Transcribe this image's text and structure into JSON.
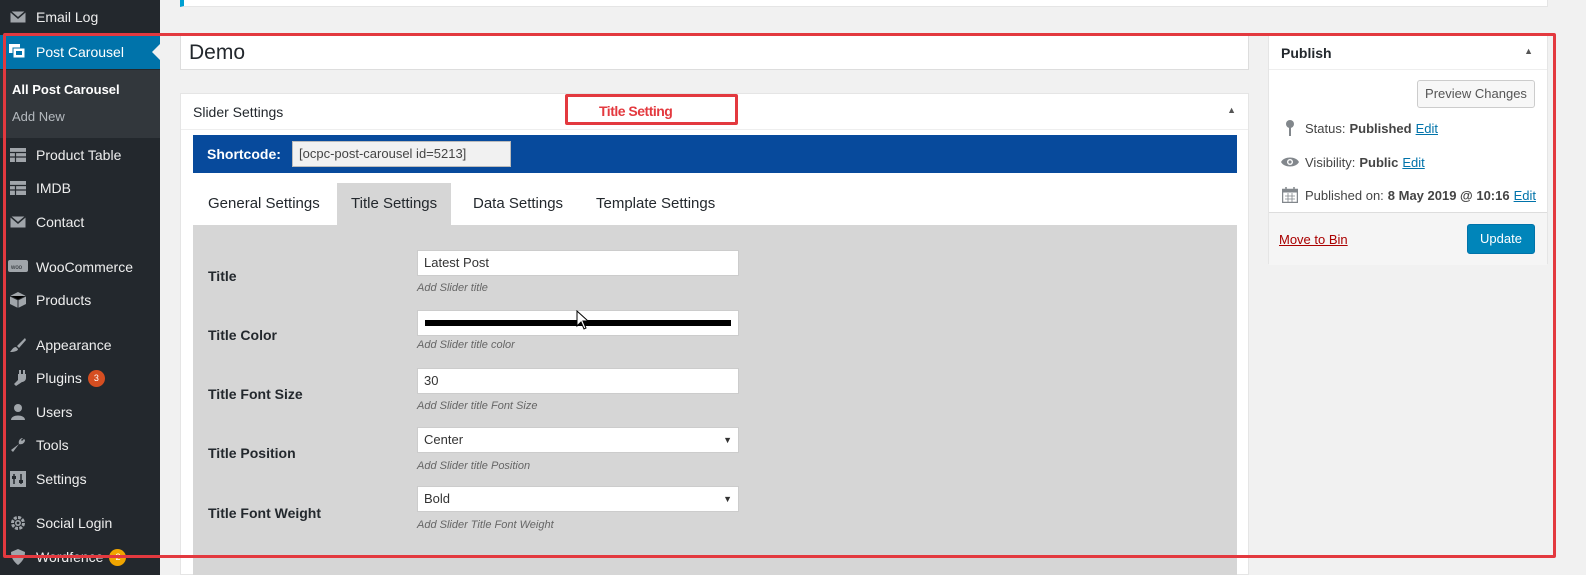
{
  "sidebar": {
    "items": [
      {
        "label": "Email Log",
        "icon": "mail-icon"
      },
      {
        "label": "Post Carousel",
        "icon": "carousel-icon",
        "active": true
      },
      {
        "label": "Product Table",
        "icon": "table-icon"
      },
      {
        "label": "IMDB",
        "icon": "table-icon"
      },
      {
        "label": "Contact",
        "icon": "mail-icon"
      },
      {
        "label": "WooCommerce",
        "icon": "woo-icon"
      },
      {
        "label": "Products",
        "icon": "box-icon"
      },
      {
        "label": "Appearance",
        "icon": "brush-icon"
      },
      {
        "label": "Plugins",
        "icon": "plug-icon",
        "badge": "3"
      },
      {
        "label": "Users",
        "icon": "user-icon"
      },
      {
        "label": "Tools",
        "icon": "wrench-icon"
      },
      {
        "label": "Settings",
        "icon": "settings-icon"
      },
      {
        "label": "Social Login",
        "icon": "gear-icon"
      },
      {
        "label": "Wordfence",
        "icon": "shield-icon",
        "badge": "2"
      }
    ],
    "submenu": {
      "all": "All Post Carousel",
      "add_new": "Add New"
    }
  },
  "post": {
    "title": "Demo"
  },
  "slider": {
    "box_title": "Slider Settings",
    "shortcode_label": "Shortcode:",
    "shortcode_value": "[ocpc-post-carousel id=5213]",
    "tabs": [
      {
        "label": "General Settings"
      },
      {
        "label": "Title Settings",
        "active": true
      },
      {
        "label": "Data Settings"
      },
      {
        "label": "Template Settings"
      }
    ],
    "fields": {
      "title": {
        "label": "Title",
        "value": "Latest Post",
        "help": "Add Slider title"
      },
      "title_color": {
        "label": "Title Color",
        "value": "#000000",
        "help": "Add Slider title color"
      },
      "font_size": {
        "label": "Title Font Size",
        "value": "30",
        "help": "Add Slider title Font Size"
      },
      "position": {
        "label": "Title Position",
        "value": "Center",
        "help": "Add Slider title Position"
      },
      "font_weight": {
        "label": "Title Font Weight",
        "value": "Bold",
        "help": "Add Slider Title Font Weight"
      }
    }
  },
  "publish": {
    "title": "Publish",
    "preview_label": "Preview Changes",
    "status_label": "Status:",
    "status_value": "Published",
    "visibility_label": "Visibility:",
    "visibility_value": "Public",
    "published_label": "Published on:",
    "published_value": "8 May 2019 @ 10:16",
    "edit_label": "Edit",
    "move_to_bin": "Move to Bin",
    "update_label": "Update"
  },
  "annotation": {
    "label": "Title Setting",
    "color": "#e3393f"
  },
  "colors": {
    "sidebar_bg": "#23282d",
    "active_menu": "#0073aa",
    "shortcode_bar": "#074a9c",
    "update_button": "#0085ba"
  }
}
